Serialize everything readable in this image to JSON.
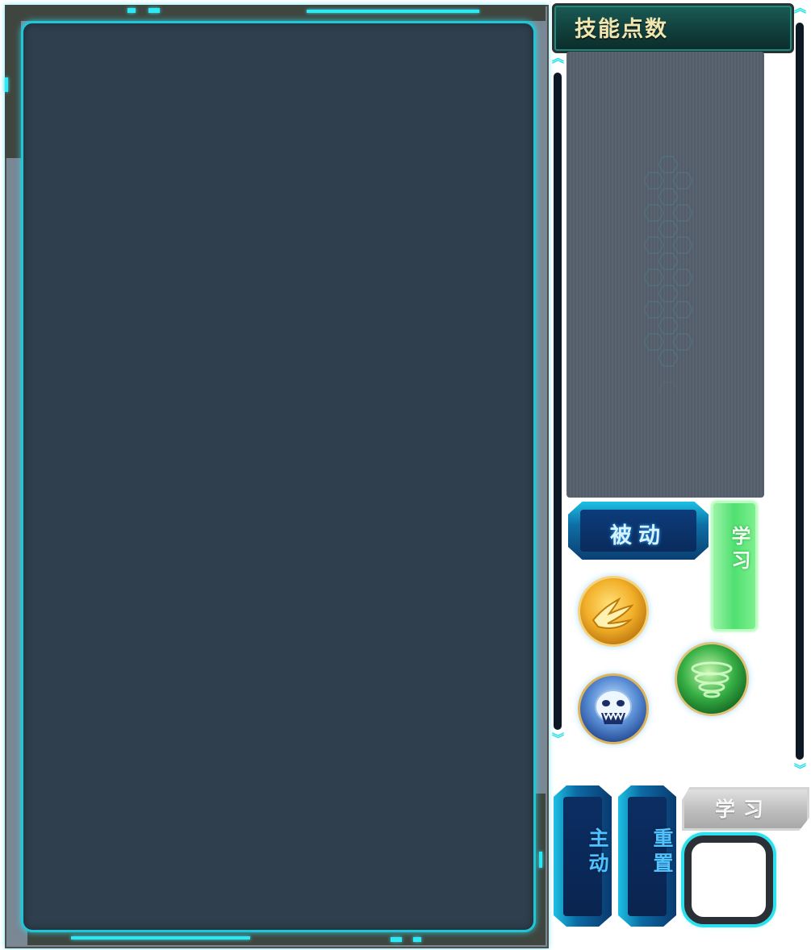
{
  "skill_points": {
    "label": "技能点数"
  },
  "tabs": {
    "passive": {
      "label": "被动"
    },
    "active": {
      "label": "主动"
    },
    "heavy": {
      "label": "重置"
    }
  },
  "buttons": {
    "learn_vertical": {
      "label": "学习",
      "state": "enabled"
    },
    "learn_horizontal": {
      "label": "学习",
      "state": "disabled"
    }
  },
  "skill_icons": [
    {
      "name": "gold-claw-icon",
      "color": "#f2b02a"
    },
    {
      "name": "ghost-skull-icon",
      "color": "#3f6fb8"
    },
    {
      "name": "green-vortex-icon",
      "color": "#37b045"
    }
  ],
  "colors": {
    "accent_cyan": "#2ee8f4",
    "panel_dark": "#2f3f4d",
    "banner_text": "#f1e6b0",
    "learn_enabled": "#4fe070",
    "learn_disabled": "#bdbdbd"
  }
}
